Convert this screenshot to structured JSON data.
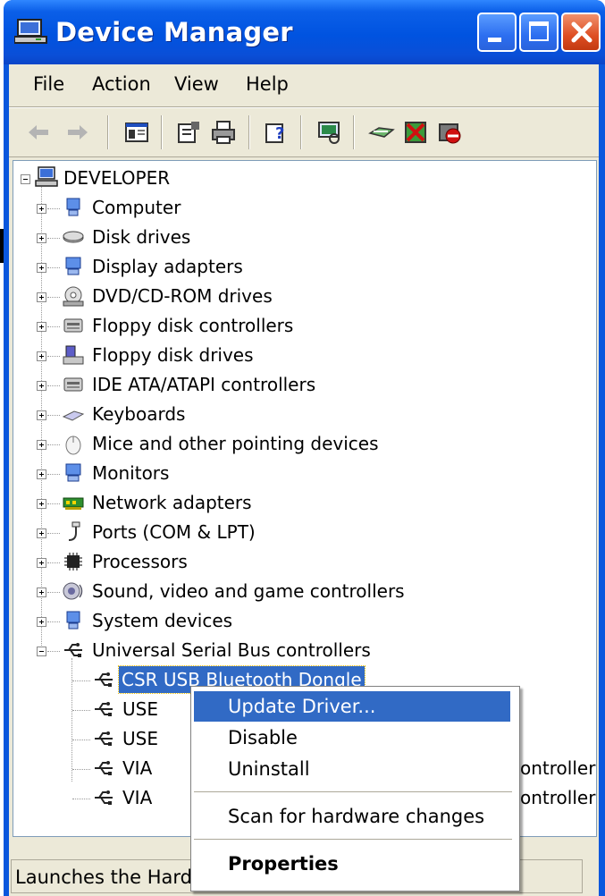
{
  "window": {
    "title": "Device Manager",
    "colors": {
      "titlebar": "#0053e0",
      "close_button": "#de4e22",
      "selection": "#316ac5"
    }
  },
  "menubar": {
    "items": [
      {
        "label": "File"
      },
      {
        "label": "Action"
      },
      {
        "label": "View"
      },
      {
        "label": "Help"
      }
    ]
  },
  "toolbar": {
    "buttons": [
      "back-arrow-icon",
      "forward-arrow-icon",
      "show-hide-console-tree-icon",
      "properties-icon",
      "print-icon",
      "help-icon",
      "scan-hardware-icon",
      "update-driver-icon",
      "uninstall-icon",
      "disable-icon"
    ]
  },
  "tree": {
    "root": "DEVELOPER",
    "categories": [
      {
        "label": "Computer",
        "icon": "computer-icon"
      },
      {
        "label": "Disk drives",
        "icon": "disk-drive-icon"
      },
      {
        "label": "Display adapters",
        "icon": "display-adapter-icon"
      },
      {
        "label": "DVD/CD-ROM drives",
        "icon": "dvd-drive-icon"
      },
      {
        "label": "Floppy disk controllers",
        "icon": "floppy-controller-icon"
      },
      {
        "label": "Floppy disk drives",
        "icon": "floppy-drive-icon"
      },
      {
        "label": "IDE ATA/ATAPI controllers",
        "icon": "ide-controller-icon"
      },
      {
        "label": "Keyboards",
        "icon": "keyboard-icon"
      },
      {
        "label": "Mice and other pointing devices",
        "icon": "mouse-icon"
      },
      {
        "label": "Monitors",
        "icon": "monitor-icon"
      },
      {
        "label": "Network adapters",
        "icon": "network-adapter-icon"
      },
      {
        "label": "Ports (COM & LPT)",
        "icon": "port-icon"
      },
      {
        "label": "Processors",
        "icon": "processor-icon"
      },
      {
        "label": "Sound, video and game controllers",
        "icon": "sound-icon"
      },
      {
        "label": "System devices",
        "icon": "system-device-icon"
      },
      {
        "label": "Universal Serial Bus controllers",
        "icon": "usb-icon"
      }
    ],
    "usb_children": [
      {
        "label": "CSR USB Bluetooth Dongle",
        "selected": true
      },
      {
        "label": "USE"
      },
      {
        "label": "USE"
      },
      {
        "label": "VIA",
        "trailing": "ontroller"
      },
      {
        "label": "VIA",
        "trailing": "ontroller"
      }
    ]
  },
  "context_menu": {
    "items": [
      {
        "label": "Update Driver...",
        "highlighted": true
      },
      {
        "label": "Disable"
      },
      {
        "label": "Uninstall"
      },
      {
        "label": "Scan for hardware changes"
      },
      {
        "label": "Properties",
        "bold": true
      }
    ]
  },
  "statusbar": {
    "text": "Launches the Hardw"
  }
}
